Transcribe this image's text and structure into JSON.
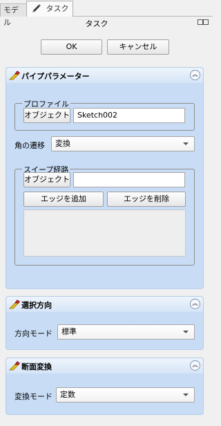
{
  "tabs": [
    {
      "label": "モデル"
    },
    {
      "label": "タスク"
    }
  ],
  "panel_title": "タスク",
  "actions": {
    "ok": "OK",
    "cancel": "キャンセル"
  },
  "pipe_params": {
    "title": "パイプパラメーター",
    "profile": {
      "legend": "プロファイル",
      "object_button": "オブジェクト",
      "value": "Sketch002"
    },
    "corner": {
      "label": "角の遷移",
      "value": "変換"
    },
    "sweep_path": {
      "legend": "スイープ経路",
      "object_button": "オブジェクト",
      "value": "",
      "add_edge": "エッジを追加",
      "remove_edge": "エッジを削除"
    }
  },
  "orientation": {
    "title": "選択方向",
    "mode_label": "方向モード",
    "mode_value": "標準"
  },
  "section_transform": {
    "title": "断面変換",
    "mode_label": "変換モード",
    "mode_value": "定数"
  },
  "icons": {
    "task_tab": "pencil-icon",
    "panel": "pipe-tool-icon",
    "collapse": "double-chevron-up-icon"
  }
}
